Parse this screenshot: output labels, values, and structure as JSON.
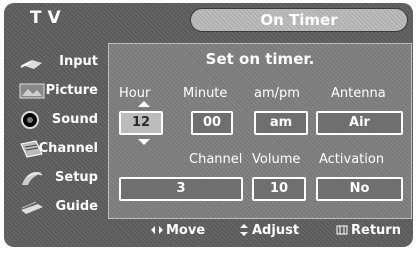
{
  "header": {
    "tv_label": "T V",
    "title": "On Timer"
  },
  "sidebar": {
    "items": [
      {
        "label": "Input",
        "icon": "input-icon"
      },
      {
        "label": "Picture",
        "icon": "picture-icon"
      },
      {
        "label": "Sound",
        "icon": "sound-icon"
      },
      {
        "label": "Channel",
        "icon": "channel-icon"
      },
      {
        "label": "Setup",
        "icon": "setup-icon"
      },
      {
        "label": "Guide",
        "icon": "guide-icon"
      }
    ]
  },
  "panel": {
    "subtitle": "Set on timer.",
    "row1_labels": {
      "hour": "Hour",
      "minute": "Minute",
      "ampm": "am/pm",
      "antenna": "Antenna"
    },
    "row1_values": {
      "hour": "12",
      "minute": "00",
      "ampm": "am",
      "antenna": "Air"
    },
    "row2_labels": {
      "channel": "Channel",
      "volume": "Volume",
      "activation": "Activation"
    },
    "row2_values": {
      "channel": "3",
      "volume": "10",
      "activation": "No"
    }
  },
  "footer": {
    "move": "Move",
    "adjust": "Adjust",
    "return": "Return"
  }
}
